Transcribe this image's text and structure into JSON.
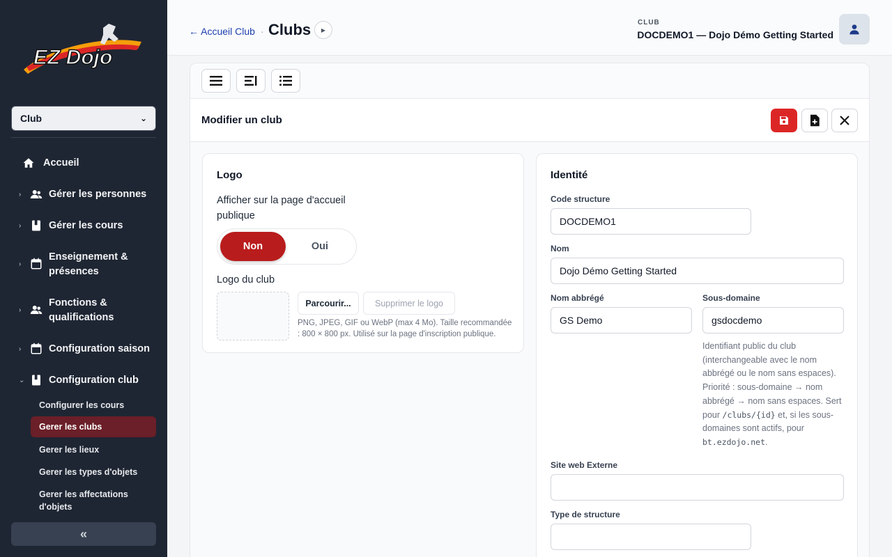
{
  "sidebar": {
    "logo_text": "EZ Dojo",
    "club_select": "Club",
    "nav": [
      {
        "label": "Accueil",
        "icon": "home-icon"
      },
      {
        "label": "Gérer les personnes",
        "icon": "people-icon"
      },
      {
        "label": "Gérer les cours",
        "icon": "book-icon"
      },
      {
        "label": "Enseignement & présences",
        "icon": "calendar-icon"
      },
      {
        "label": "Fonctions & qualifications",
        "icon": "people-icon"
      },
      {
        "label": "Configuration saison",
        "icon": "calendar-icon"
      },
      {
        "label": "Configuration club",
        "icon": "book-icon"
      }
    ],
    "sub": [
      "Configurer les cours",
      "Gerer les clubs",
      "Gerer les lieux",
      "Gerer les types d'objets",
      "Gerer les affectations d'objets"
    ],
    "collapse": "«"
  },
  "header": {
    "back": "← Accueil Club",
    "sep": "·",
    "title": "Clubs",
    "club_label": "CLUB",
    "club_name": "DOCDEMO1 — Dojo Démo Getting Started"
  },
  "form": {
    "title": "Modifier un club",
    "logo": {
      "title": "Logo",
      "show_label": "Afficher sur la page d'accueil publique",
      "toggle_no": "Non",
      "toggle_yes": "Oui",
      "logo_label": "Logo du club",
      "browse": "Parcourir...",
      "remove": "Supprimer le logo",
      "hint": "PNG, JPEG, GIF ou WebP (max 4 Mo). Taille recommandée : 800 × 800 px. Utilisé sur la page d'inscription publique."
    },
    "identity": {
      "title": "Identité",
      "code_label": "Code structure",
      "code_value": "DOCDEMO1",
      "name_label": "Nom",
      "name_value": "Dojo Démo Getting Started",
      "short_label": "Nom abbrégé",
      "short_value": "GS Demo",
      "sub_label": "Sous-domaine",
      "sub_value": "gsdocdemo",
      "help_1": "Identifiant public du club (interchangeable avec le nom abbrégé ou le nom sans espaces). Priorité : sous-domaine → nom abbrégé → nom sans espaces. Sert pour",
      "help_code_1": "/clubs/{id}",
      "help_2": "et, si les sous-domaines sont actifs, pour",
      "help_code_2": "bt.ezdojo.net",
      "help_3": ".",
      "web_label": "Site web Externe",
      "web_value": "",
      "type_label": "Type de structure",
      "type_value": ""
    }
  },
  "colors": {
    "sidebar_bg": "#1f2633",
    "accent_red": "#dc2626",
    "active_item": "#6b1f28",
    "link_blue": "#1e40af"
  }
}
